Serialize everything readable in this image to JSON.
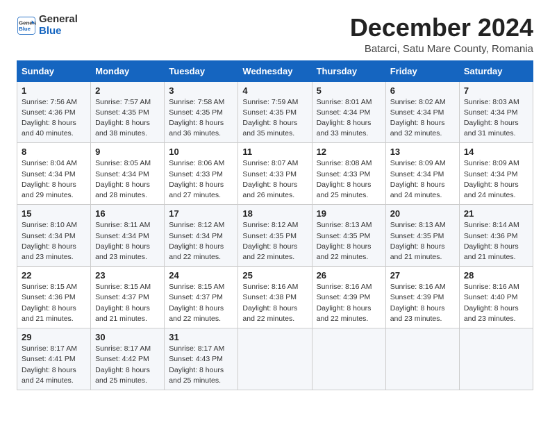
{
  "logo": {
    "line1": "General",
    "line2": "Blue"
  },
  "title": "December 2024",
  "subtitle": "Batarci, Satu Mare County, Romania",
  "weekdays": [
    "Sunday",
    "Monday",
    "Tuesday",
    "Wednesday",
    "Thursday",
    "Friday",
    "Saturday"
  ],
  "weeks": [
    [
      {
        "day": "1",
        "sunrise": "7:56 AM",
        "sunset": "4:36 PM",
        "daylight": "8 hours and 40 minutes."
      },
      {
        "day": "2",
        "sunrise": "7:57 AM",
        "sunset": "4:35 PM",
        "daylight": "8 hours and 38 minutes."
      },
      {
        "day": "3",
        "sunrise": "7:58 AM",
        "sunset": "4:35 PM",
        "daylight": "8 hours and 36 minutes."
      },
      {
        "day": "4",
        "sunrise": "7:59 AM",
        "sunset": "4:35 PM",
        "daylight": "8 hours and 35 minutes."
      },
      {
        "day": "5",
        "sunrise": "8:01 AM",
        "sunset": "4:34 PM",
        "daylight": "8 hours and 33 minutes."
      },
      {
        "day": "6",
        "sunrise": "8:02 AM",
        "sunset": "4:34 PM",
        "daylight": "8 hours and 32 minutes."
      },
      {
        "day": "7",
        "sunrise": "8:03 AM",
        "sunset": "4:34 PM",
        "daylight": "8 hours and 31 minutes."
      }
    ],
    [
      {
        "day": "8",
        "sunrise": "8:04 AM",
        "sunset": "4:34 PM",
        "daylight": "8 hours and 29 minutes."
      },
      {
        "day": "9",
        "sunrise": "8:05 AM",
        "sunset": "4:34 PM",
        "daylight": "8 hours and 28 minutes."
      },
      {
        "day": "10",
        "sunrise": "8:06 AM",
        "sunset": "4:33 PM",
        "daylight": "8 hours and 27 minutes."
      },
      {
        "day": "11",
        "sunrise": "8:07 AM",
        "sunset": "4:33 PM",
        "daylight": "8 hours and 26 minutes."
      },
      {
        "day": "12",
        "sunrise": "8:08 AM",
        "sunset": "4:33 PM",
        "daylight": "8 hours and 25 minutes."
      },
      {
        "day": "13",
        "sunrise": "8:09 AM",
        "sunset": "4:34 PM",
        "daylight": "8 hours and 24 minutes."
      },
      {
        "day": "14",
        "sunrise": "8:09 AM",
        "sunset": "4:34 PM",
        "daylight": "8 hours and 24 minutes."
      }
    ],
    [
      {
        "day": "15",
        "sunrise": "8:10 AM",
        "sunset": "4:34 PM",
        "daylight": "8 hours and 23 minutes."
      },
      {
        "day": "16",
        "sunrise": "8:11 AM",
        "sunset": "4:34 PM",
        "daylight": "8 hours and 23 minutes."
      },
      {
        "day": "17",
        "sunrise": "8:12 AM",
        "sunset": "4:34 PM",
        "daylight": "8 hours and 22 minutes."
      },
      {
        "day": "18",
        "sunrise": "8:12 AM",
        "sunset": "4:35 PM",
        "daylight": "8 hours and 22 minutes."
      },
      {
        "day": "19",
        "sunrise": "8:13 AM",
        "sunset": "4:35 PM",
        "daylight": "8 hours and 22 minutes."
      },
      {
        "day": "20",
        "sunrise": "8:13 AM",
        "sunset": "4:35 PM",
        "daylight": "8 hours and 21 minutes."
      },
      {
        "day": "21",
        "sunrise": "8:14 AM",
        "sunset": "4:36 PM",
        "daylight": "8 hours and 21 minutes."
      }
    ],
    [
      {
        "day": "22",
        "sunrise": "8:15 AM",
        "sunset": "4:36 PM",
        "daylight": "8 hours and 21 minutes."
      },
      {
        "day": "23",
        "sunrise": "8:15 AM",
        "sunset": "4:37 PM",
        "daylight": "8 hours and 21 minutes."
      },
      {
        "day": "24",
        "sunrise": "8:15 AM",
        "sunset": "4:37 PM",
        "daylight": "8 hours and 22 minutes."
      },
      {
        "day": "25",
        "sunrise": "8:16 AM",
        "sunset": "4:38 PM",
        "daylight": "8 hours and 22 minutes."
      },
      {
        "day": "26",
        "sunrise": "8:16 AM",
        "sunset": "4:39 PM",
        "daylight": "8 hours and 22 minutes."
      },
      {
        "day": "27",
        "sunrise": "8:16 AM",
        "sunset": "4:39 PM",
        "daylight": "8 hours and 23 minutes."
      },
      {
        "day": "28",
        "sunrise": "8:16 AM",
        "sunset": "4:40 PM",
        "daylight": "8 hours and 23 minutes."
      }
    ],
    [
      {
        "day": "29",
        "sunrise": "8:17 AM",
        "sunset": "4:41 PM",
        "daylight": "8 hours and 24 minutes."
      },
      {
        "day": "30",
        "sunrise": "8:17 AM",
        "sunset": "4:42 PM",
        "daylight": "8 hours and 25 minutes."
      },
      {
        "day": "31",
        "sunrise": "8:17 AM",
        "sunset": "4:43 PM",
        "daylight": "8 hours and 25 minutes."
      },
      null,
      null,
      null,
      null
    ]
  ]
}
